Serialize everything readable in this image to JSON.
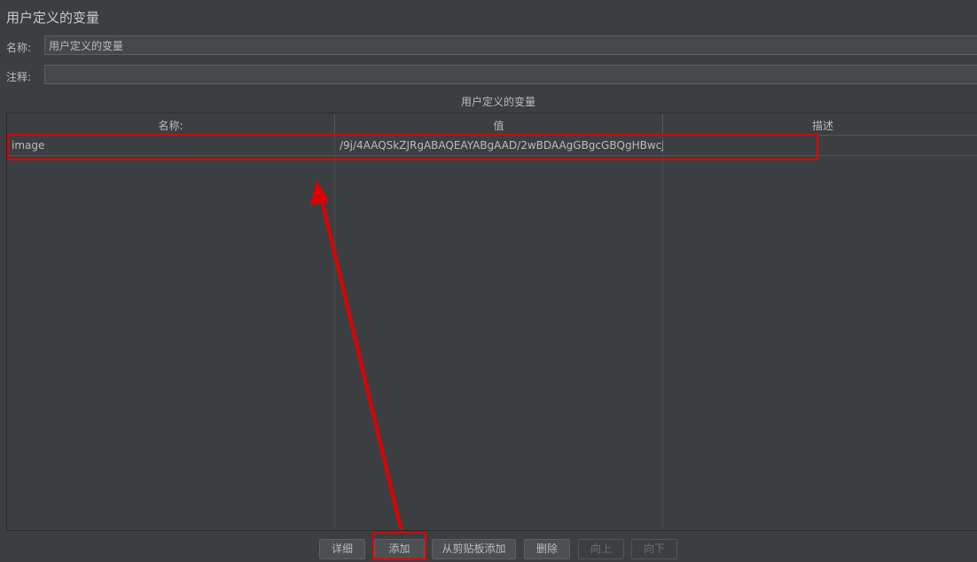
{
  "panel": {
    "title": "用户定义的变量"
  },
  "form": {
    "name_label": "名称:",
    "name_value": "用户定义的变量",
    "comment_label": "注释:",
    "comment_value": ""
  },
  "table": {
    "caption": "用户定义的变量",
    "headers": [
      "名称:",
      "值",
      "描述"
    ],
    "rows": [
      {
        "name": "image",
        "value": "/9j/4AAQSkZJRgABAQEAYABgAAD/2wBDAAgGBgcGBQgHBwcJC...",
        "description": ""
      }
    ]
  },
  "buttons": {
    "detail": "详细",
    "add": "添加",
    "add_from_clipboard": "从剪贴板添加",
    "delete": "删除",
    "up": "向上",
    "down": "向下"
  },
  "annotation_color": "#e00000"
}
